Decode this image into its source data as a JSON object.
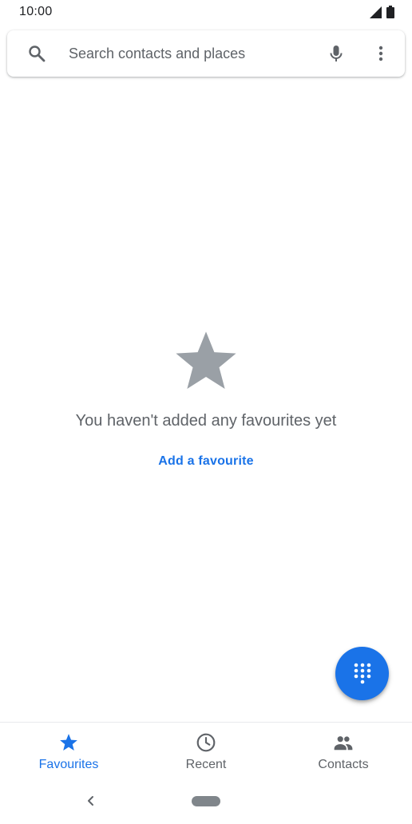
{
  "status_bar": {
    "time": "10:00"
  },
  "search": {
    "placeholder": "Search contacts and places",
    "icons": [
      "search-icon",
      "mic-icon",
      "more-vert-icon"
    ]
  },
  "empty_state": {
    "icon": "star-icon",
    "message": "You haven't added any favourites yet",
    "action_label": "Add a favourite"
  },
  "fab": {
    "icon": "dialpad-icon"
  },
  "bottom_nav": {
    "items": [
      {
        "label": "Favourites",
        "icon": "star-icon",
        "active": true
      },
      {
        "label": "Recent",
        "icon": "clock-icon",
        "active": false
      },
      {
        "label": "Contacts",
        "icon": "people-icon",
        "active": false
      }
    ]
  },
  "colors": {
    "accent": "#1a73e8",
    "secondary_text": "#5f6368",
    "star_gray": "#9aa0a6",
    "icon_dark": "#5f6368"
  }
}
